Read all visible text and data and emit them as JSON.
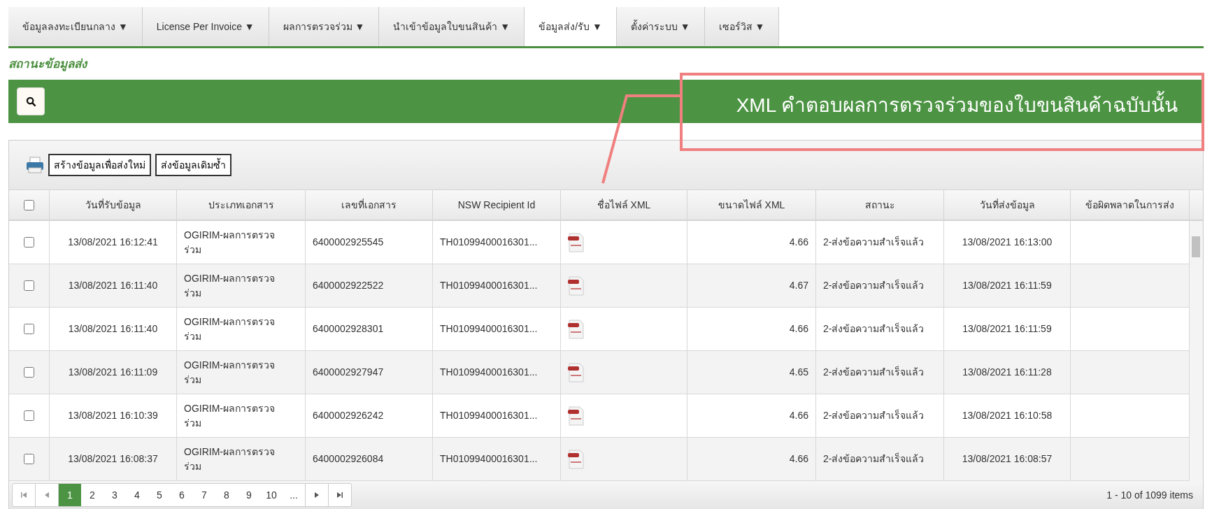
{
  "nav": [
    {
      "label": "ข้อมูลลงทะเบียนกลาง ▼",
      "selected": false
    },
    {
      "label": "License Per Invoice ▼",
      "selected": false
    },
    {
      "label": "ผลการตรวจร่วม ▼",
      "selected": false
    },
    {
      "label": "นำเข้าข้อมูลใบขนสินค้า ▼",
      "selected": false
    },
    {
      "label": "ข้อมูลส่ง/รับ ▼",
      "selected": true
    },
    {
      "label": "ตั้งค่าระบบ ▼",
      "selected": false
    },
    {
      "label": "เซอร์วิส ▼",
      "selected": false
    }
  ],
  "page_title": "สถานะข้อมูลส่ง",
  "annotation": "XML คำตอบผลการตรวจร่วมของใบขนสินค้าฉบับนั้น",
  "toolbar": {
    "buttons": [
      "สร้างข้อมูลเพื่อส่งใหม่",
      "ส่งข้อมูลเดิมซ้ำ"
    ]
  },
  "table": {
    "select_all_checked": false,
    "columns": [
      "วันที่รับข้อมูล",
      "ประเภทเอกสาร",
      "เลขที่เอกสาร",
      "NSW Recipient Id",
      "ชื่อไฟล์ XML",
      "ขนาดไฟล์ XML",
      "สถานะ",
      "วันที่ส่งข้อมูล",
      "ข้อผิดพลาดในการส่ง"
    ],
    "rows": [
      {
        "checked": false,
        "received": "13/08/2021 16:12:41",
        "doc_type": "OGIRIM-ผลการตรวจร่วม",
        "doc_no": "6400002925545",
        "recipient": "TH01099400016301...",
        "size": "4.66",
        "status": "2-ส่งข้อความสำเร็จแล้ว",
        "sent": "13/08/2021 16:13:00"
      },
      {
        "checked": false,
        "received": "13/08/2021 16:11:40",
        "doc_type": "OGIRIM-ผลการตรวจร่วม",
        "doc_no": "6400002922522",
        "recipient": "TH01099400016301...",
        "size": "4.67",
        "status": "2-ส่งข้อความสำเร็จแล้ว",
        "sent": "13/08/2021 16:11:59"
      },
      {
        "checked": false,
        "received": "13/08/2021 16:11:40",
        "doc_type": "OGIRIM-ผลการตรวจร่วม",
        "doc_no": "6400002928301",
        "recipient": "TH01099400016301...",
        "size": "4.66",
        "status": "2-ส่งข้อความสำเร็จแล้ว",
        "sent": "13/08/2021 16:11:59"
      },
      {
        "checked": false,
        "received": "13/08/2021 16:11:09",
        "doc_type": "OGIRIM-ผลการตรวจร่วม",
        "doc_no": "6400002927947",
        "recipient": "TH01099400016301...",
        "size": "4.65",
        "status": "2-ส่งข้อความสำเร็จแล้ว",
        "sent": "13/08/2021 16:11:28"
      },
      {
        "checked": false,
        "received": "13/08/2021 16:10:39",
        "doc_type": "OGIRIM-ผลการตรวจร่วม",
        "doc_no": "6400002926242",
        "recipient": "TH01099400016301...",
        "size": "4.66",
        "status": "2-ส่งข้อความสำเร็จแล้ว",
        "sent": "13/08/2021 16:10:58"
      },
      {
        "checked": false,
        "received": "13/08/2021 16:08:37",
        "doc_type": "OGIRIM-ผลการตรวจร่วม",
        "doc_no": "6400002926084",
        "recipient": "TH01099400016301...",
        "size": "4.66",
        "status": "2-ส่งข้อความสำเร็จแล้ว",
        "sent": "13/08/2021 16:08:57"
      }
    ]
  },
  "pager": {
    "pages": [
      {
        "label": "1",
        "selected": true
      },
      {
        "label": "2",
        "selected": false
      },
      {
        "label": "3",
        "selected": false
      },
      {
        "label": "4",
        "selected": false
      },
      {
        "label": "5",
        "selected": false
      },
      {
        "label": "6",
        "selected": false
      },
      {
        "label": "7",
        "selected": false
      },
      {
        "label": "8",
        "selected": false
      },
      {
        "label": "9",
        "selected": false
      },
      {
        "label": "10",
        "selected": false
      },
      {
        "label": "...",
        "selected": false
      }
    ],
    "summary": "1 - 10 of 1099 items"
  }
}
